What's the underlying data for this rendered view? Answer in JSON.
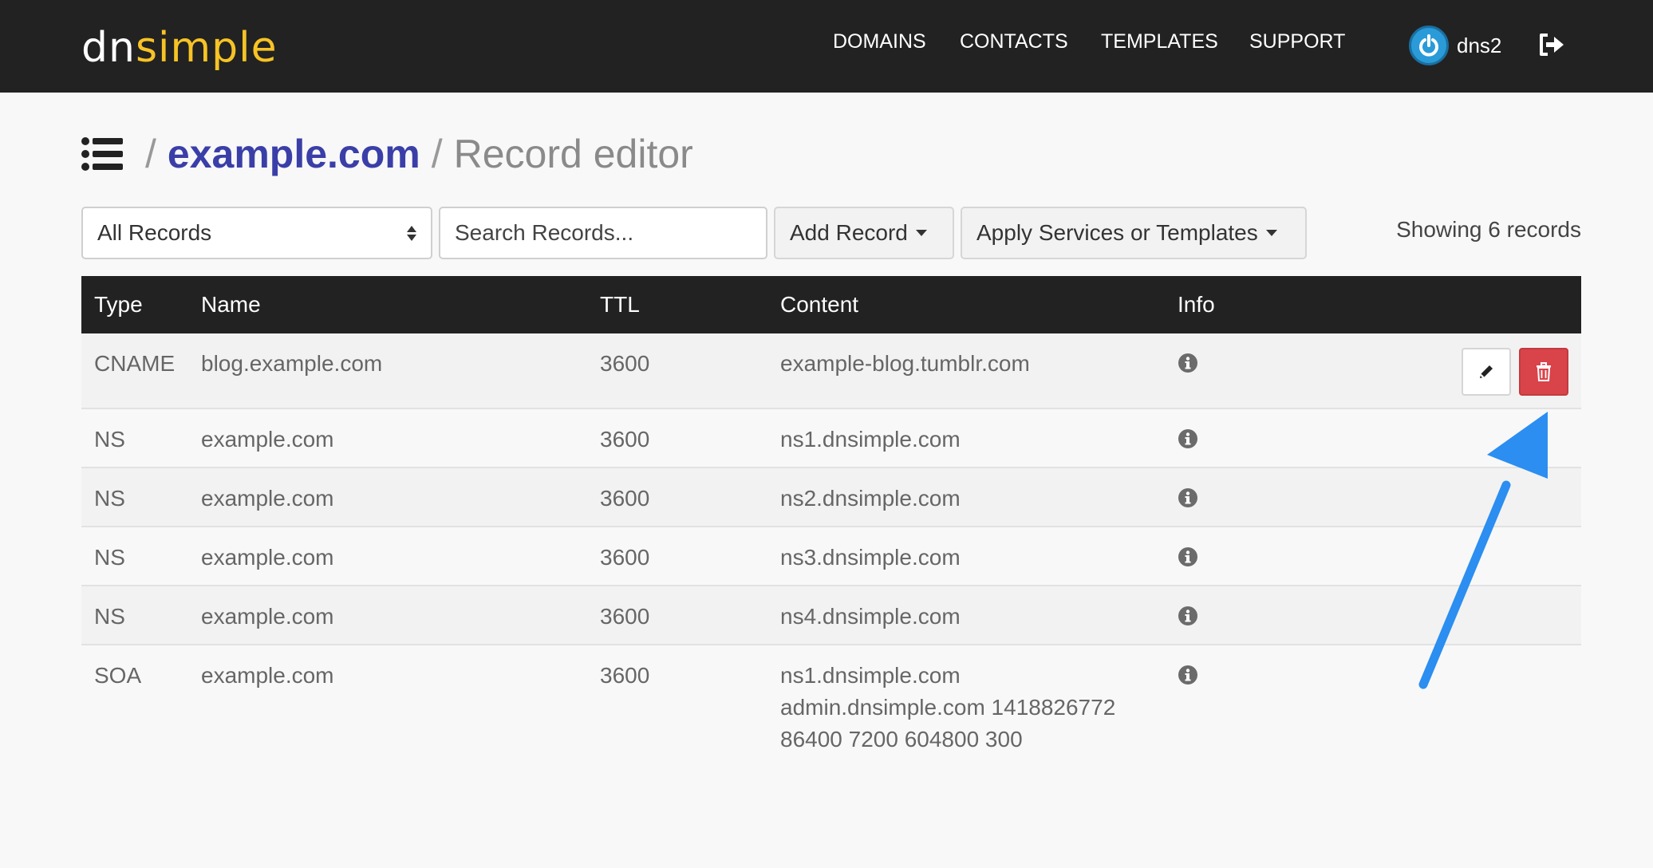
{
  "brand": {
    "logo_dn": "dn",
    "logo_simple": "simple",
    "accent": "#f7c325"
  },
  "nav": {
    "items": [
      "DOMAINS",
      "CONTACTS",
      "TEMPLATES",
      "SUPPORT"
    ]
  },
  "user": {
    "name": "dns2",
    "avatar_icon": "power-icon",
    "logout_icon": "sign-out-icon"
  },
  "breadcrumb": {
    "menu_icon": "list-icon",
    "separator": "/",
    "domain": "example.com",
    "page": "Record editor",
    "domain_color": "#3a3fa8"
  },
  "toolbar": {
    "filter_value": "All Records",
    "search_placeholder": "Search Records...",
    "add_record_label": "Add Record",
    "apply_label": "Apply Services or Templates",
    "showing_text": "Showing 6 records"
  },
  "table": {
    "headers": [
      "Type",
      "Name",
      "TTL",
      "Content",
      "Info"
    ],
    "rows": [
      {
        "type": "CNAME",
        "name": "blog.example.com",
        "ttl": "3600",
        "content": [
          "example-blog.tumblr.com"
        ]
      },
      {
        "type": "NS",
        "name": "example.com",
        "ttl": "3600",
        "content": [
          "ns1.dnsimple.com"
        ]
      },
      {
        "type": "NS",
        "name": "example.com",
        "ttl": "3600",
        "content": [
          "ns2.dnsimple.com"
        ]
      },
      {
        "type": "NS",
        "name": "example.com",
        "ttl": "3600",
        "content": [
          "ns3.dnsimple.com"
        ]
      },
      {
        "type": "NS",
        "name": "example.com",
        "ttl": "3600",
        "content": [
          "ns4.dnsimple.com"
        ]
      },
      {
        "type": "SOA",
        "name": "example.com",
        "ttl": "3600",
        "content": [
          "ns1.dnsimple.com",
          "admin.dnsimple.com 1418826772",
          "86400 7200 604800 300"
        ]
      }
    ],
    "info_icon": "info-circle-icon",
    "edit_icon": "pencil-icon",
    "delete_icon": "trash-icon",
    "delete_color": "#d9434a"
  },
  "annotation": {
    "arrow_color": "#2b8ef0",
    "arrow_icon": "callout-arrow-icon"
  }
}
